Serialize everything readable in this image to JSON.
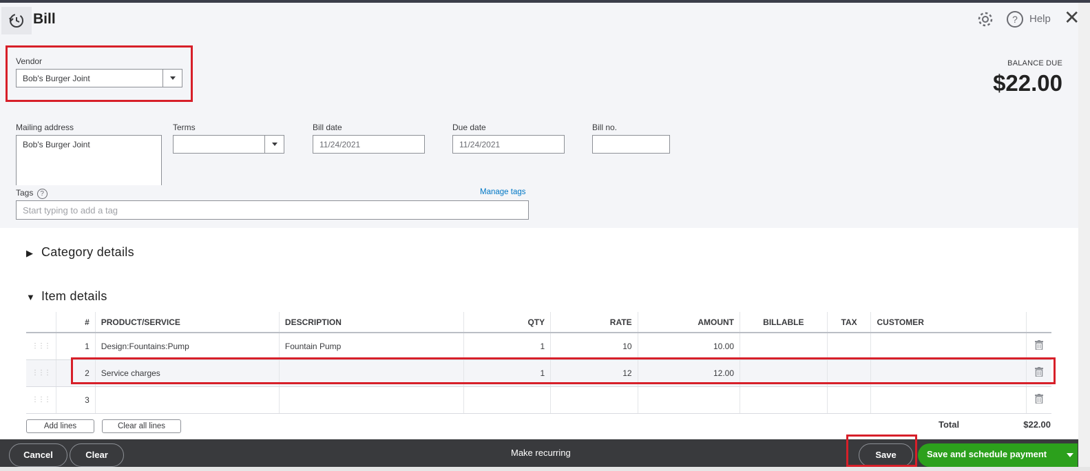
{
  "header": {
    "title": "Bill",
    "help_label": "Help",
    "balance_label": "BALANCE DUE",
    "balance_amount": "$22.00"
  },
  "vendor": {
    "label": "Vendor",
    "value": "Bob's Burger Joint"
  },
  "mailing": {
    "label": "Mailing address",
    "value": "Bob's Burger Joint"
  },
  "terms": {
    "label": "Terms",
    "value": ""
  },
  "bill_date": {
    "label": "Bill date",
    "value": "11/24/2021"
  },
  "due_date": {
    "label": "Due date",
    "value": "11/24/2021"
  },
  "bill_no": {
    "label": "Bill no.",
    "value": ""
  },
  "tags": {
    "label": "Tags",
    "manage": "Manage tags",
    "placeholder": "Start typing to add a tag"
  },
  "sections": {
    "category": "Category details",
    "item": "Item details"
  },
  "table": {
    "headers": [
      "#",
      "PRODUCT/SERVICE",
      "DESCRIPTION",
      "QTY",
      "RATE",
      "AMOUNT",
      "BILLABLE",
      "TAX",
      "CUSTOMER"
    ],
    "rows": [
      {
        "num": "1",
        "product": "Design:Fountains:Pump",
        "description": "Fountain Pump",
        "qty": "1",
        "rate": "10",
        "amount": "10.00"
      },
      {
        "num": "2",
        "product": "Service charges",
        "description": "",
        "qty": "1",
        "rate": "12",
        "amount": "12.00"
      },
      {
        "num": "3",
        "product": "",
        "description": "",
        "qty": "",
        "rate": "",
        "amount": ""
      }
    ]
  },
  "actions": {
    "add_lines": "Add lines",
    "clear_all": "Clear all lines"
  },
  "total": {
    "label": "Total",
    "amount": "$22.00"
  },
  "footer": {
    "cancel": "Cancel",
    "clear": "Clear",
    "recurring": "Make recurring",
    "save": "Save",
    "save_schedule": "Save and schedule payment"
  },
  "colors": {
    "highlight": "#d71f29",
    "primary_green": "#2ca01c",
    "footer_bg": "#393a3d"
  }
}
